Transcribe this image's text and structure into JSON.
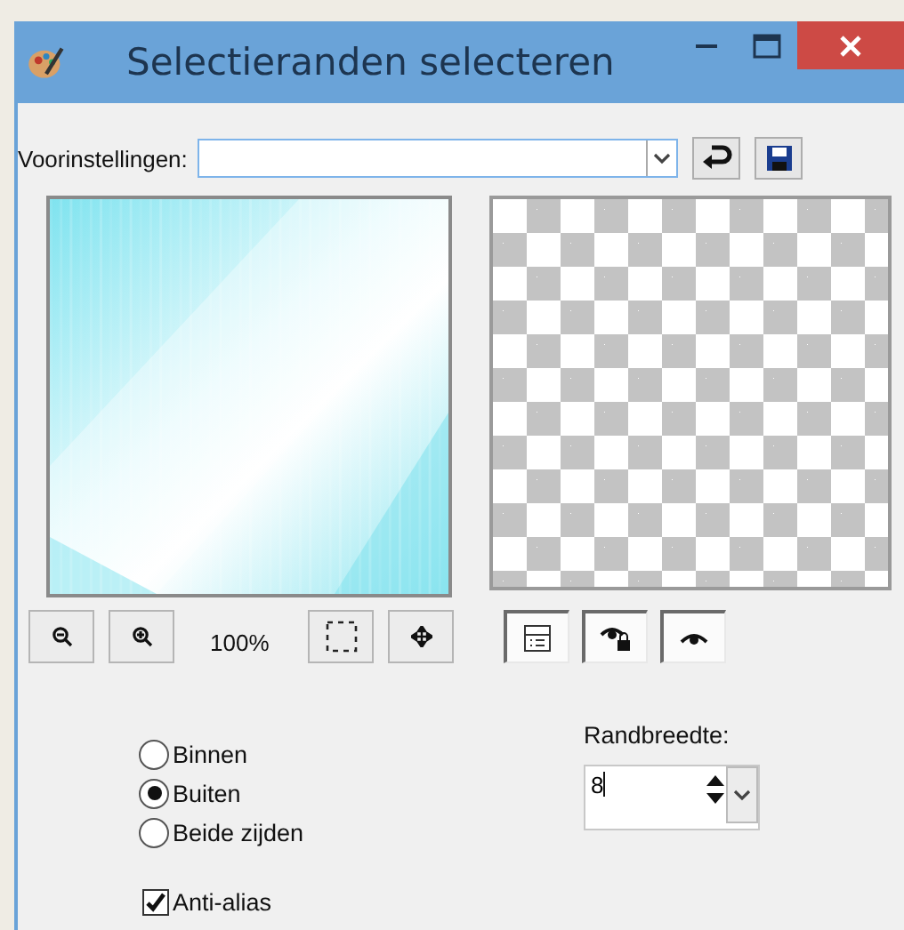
{
  "window": {
    "title": "Selectieranden selecteren"
  },
  "presets": {
    "label": "Voorinstellingen:"
  },
  "zoom": {
    "reading": "100%"
  },
  "view_toggles": [
    {
      "kind": "properties",
      "pressed": true
    },
    {
      "kind": "eye-lock",
      "pressed": true
    },
    {
      "kind": "eye",
      "pressed": true
    }
  ],
  "side_options": [
    {
      "label": "Binnen",
      "selected": false
    },
    {
      "label": "Buiten",
      "selected": true
    },
    {
      "label": "Beide zijden",
      "selected": false
    }
  ],
  "border_width": {
    "label": "Randbreedte:",
    "value": "8"
  },
  "anti_alias": {
    "label": "Anti-alias",
    "checked": true
  }
}
